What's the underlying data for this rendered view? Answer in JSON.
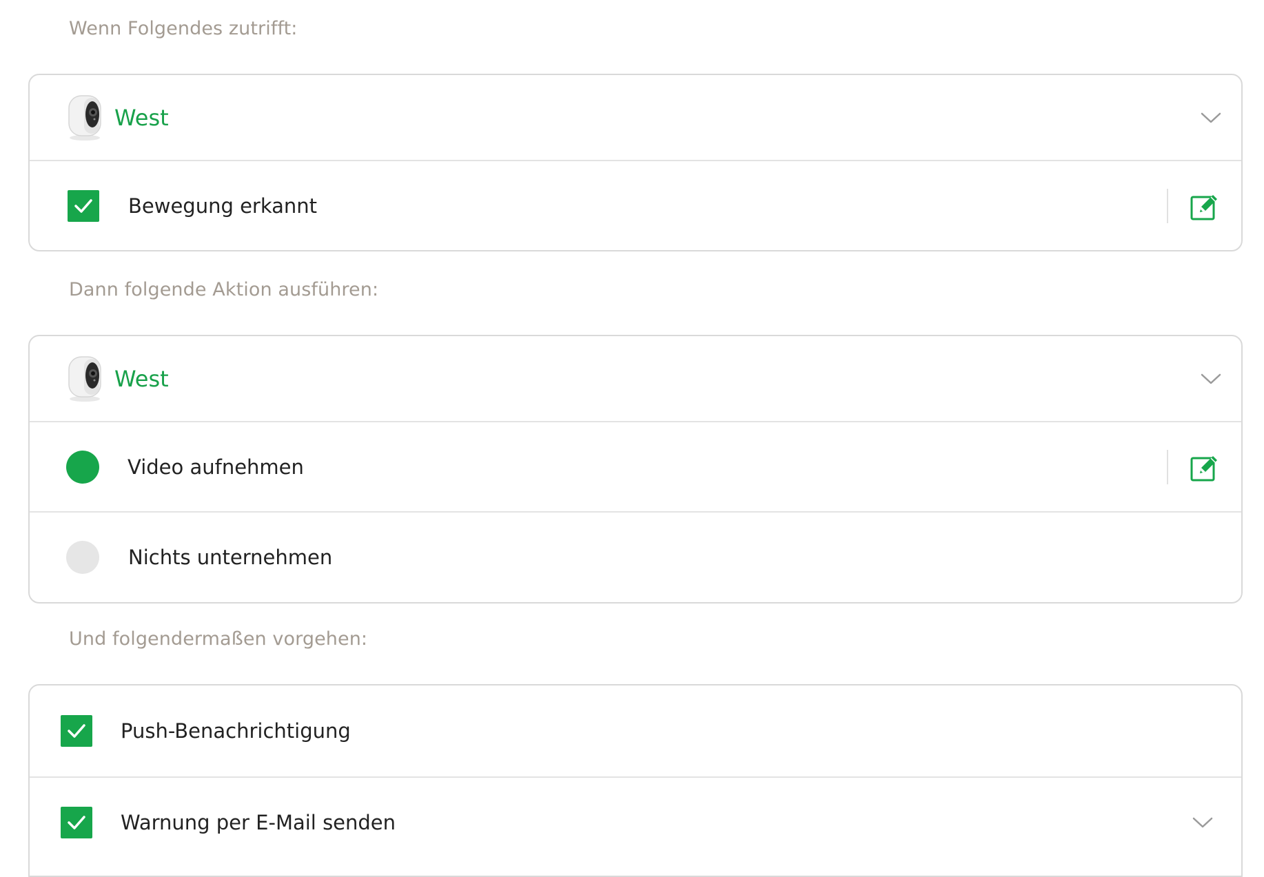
{
  "trigger": {
    "label": "Wenn Folgendes zutrifft:",
    "device": {
      "name": "West",
      "icon": "camera-thumbnail"
    },
    "condition": {
      "label": "Bewegung erkannt",
      "checked": true
    }
  },
  "action": {
    "label": "Dann folgende Aktion ausführen:",
    "device": {
      "name": "West",
      "icon": "camera-thumbnail"
    },
    "options": [
      {
        "label": "Video aufnehmen",
        "selected": true
      },
      {
        "label": "Nichts unternehmen",
        "selected": false
      }
    ]
  },
  "notify": {
    "label": "Und folgendermaßen vorgehen:",
    "options": [
      {
        "label": "Push-Benachrichtigung",
        "checked": true
      },
      {
        "label": "Warnung per E-Mail senden",
        "checked": true
      }
    ]
  },
  "colors": {
    "accent": "#17a64b",
    "accent_text": "#18a14a",
    "section_label": "#a39b92",
    "border": "#d9d9d9",
    "radio_off": "#e6e6e6"
  }
}
